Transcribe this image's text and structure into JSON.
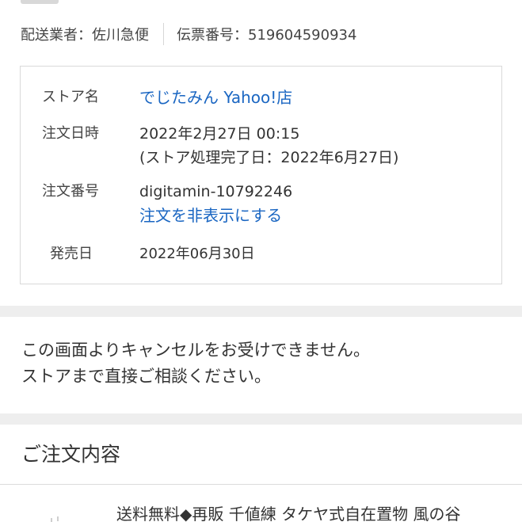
{
  "shipping": {
    "carrier_label": "配送業者：佐川急便",
    "tracking_label": "伝票番号：519604590934"
  },
  "order_info": {
    "store_label": "ストア名",
    "store_name": "でじたみん Yahoo!店",
    "datetime_label": "注文日時",
    "datetime_value": "2022年2月27日 00:15",
    "datetime_note": "(ストア処理完了日：2022年6月27日)",
    "order_no_label": "注文番号",
    "order_no_value": "digitamin-10792246",
    "hide_order_link": "注文を非表示にする",
    "release_label": "発売日",
    "release_value": "2022年06月30日"
  },
  "notice": {
    "line1": "この画面よりキャンセルをお受けできません。",
    "line2": "ストアまで直接ご相談ください。"
  },
  "order_contents": {
    "title": "ご注文内容",
    "product_title": "送料無料◆再販 千値練 タケヤ式自在置物 風の谷"
  }
}
